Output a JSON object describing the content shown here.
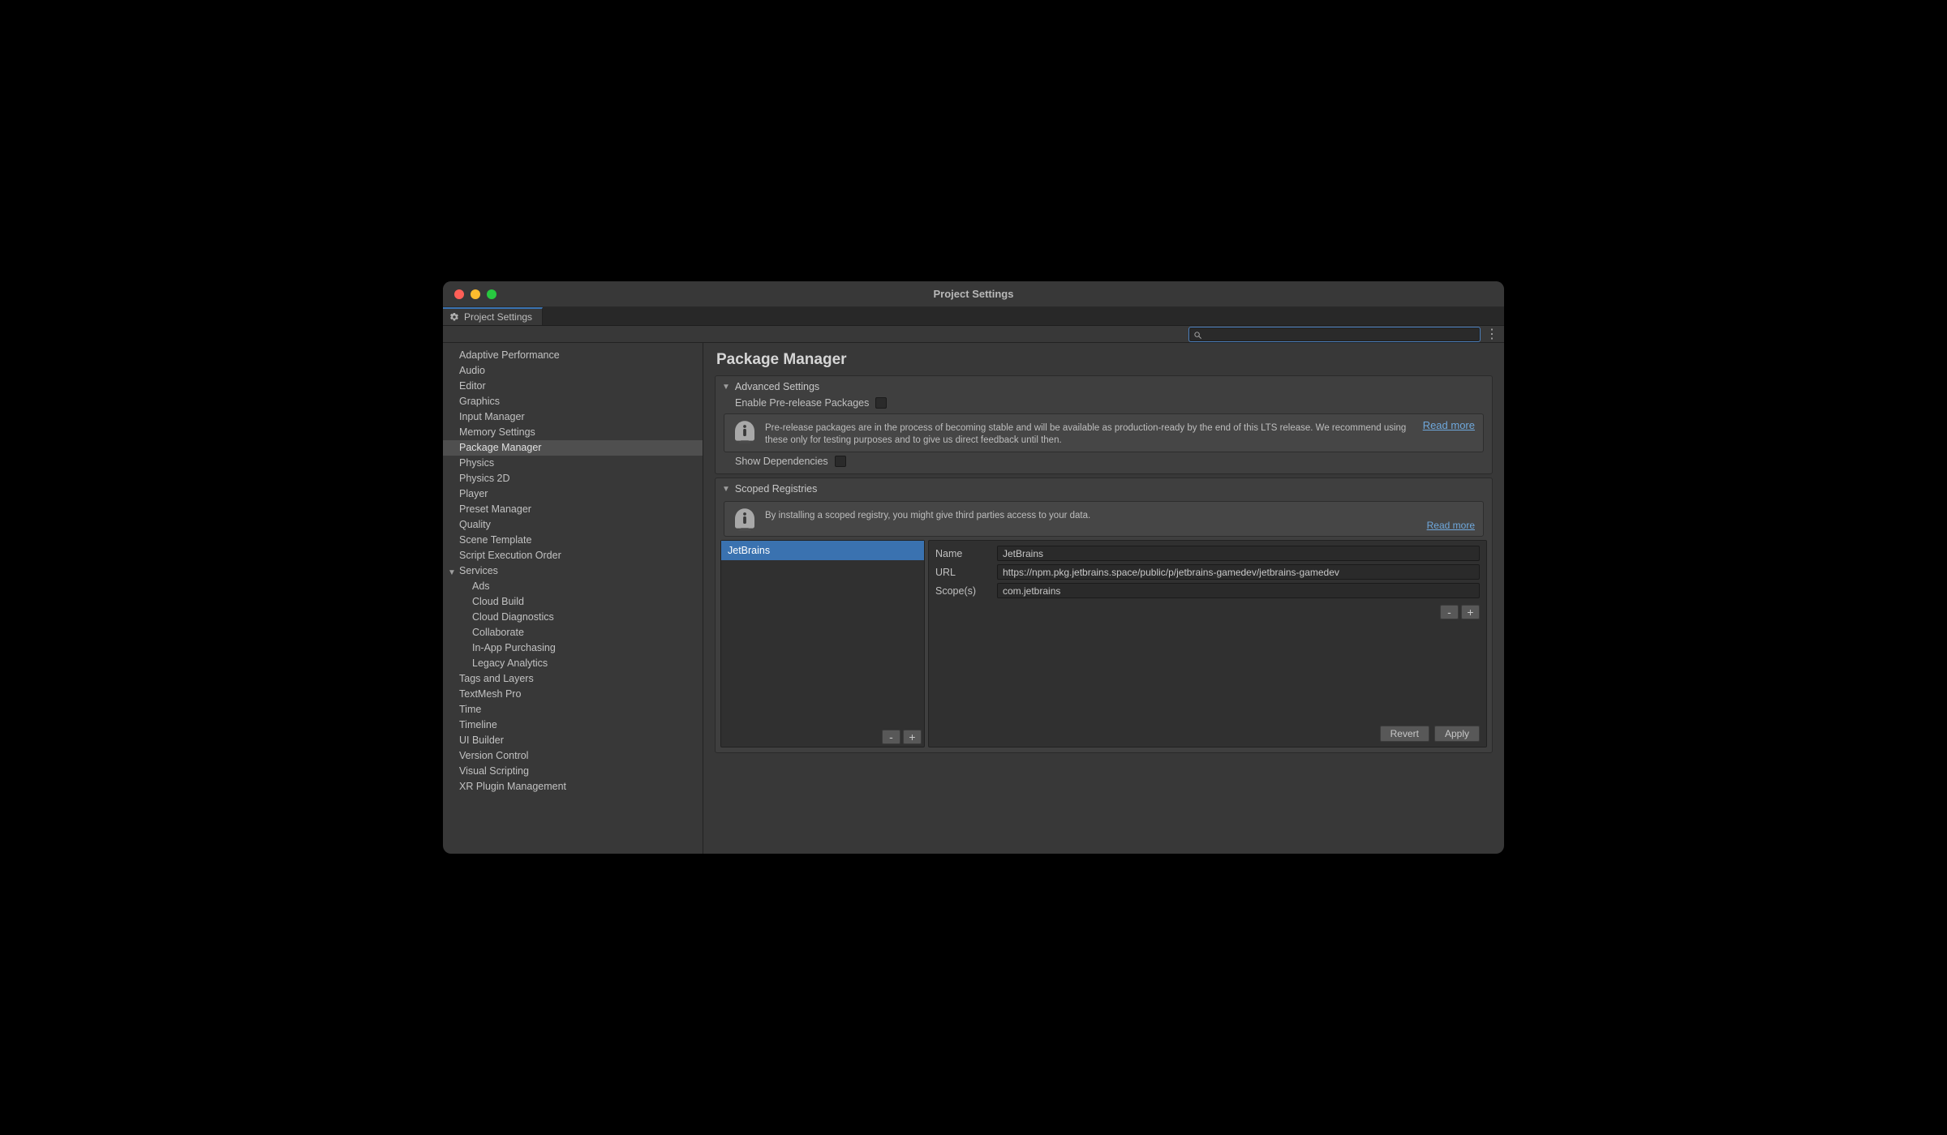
{
  "window": {
    "title": "Project Settings",
    "tab_label": "Project Settings"
  },
  "sidebar": {
    "items": [
      {
        "label": "Adaptive Performance",
        "selected": false
      },
      {
        "label": "Audio",
        "selected": false
      },
      {
        "label": "Editor",
        "selected": false
      },
      {
        "label": "Graphics",
        "selected": false
      },
      {
        "label": "Input Manager",
        "selected": false
      },
      {
        "label": "Memory Settings",
        "selected": false
      },
      {
        "label": "Package Manager",
        "selected": true
      },
      {
        "label": "Physics",
        "selected": false
      },
      {
        "label": "Physics 2D",
        "selected": false
      },
      {
        "label": "Player",
        "selected": false
      },
      {
        "label": "Preset Manager",
        "selected": false
      },
      {
        "label": "Quality",
        "selected": false
      },
      {
        "label": "Scene Template",
        "selected": false
      },
      {
        "label": "Script Execution Order",
        "selected": false
      },
      {
        "label": "Services",
        "selected": false,
        "has_children": true
      },
      {
        "label": "Ads",
        "selected": false,
        "child": true
      },
      {
        "label": "Cloud Build",
        "selected": false,
        "child": true
      },
      {
        "label": "Cloud Diagnostics",
        "selected": false,
        "child": true
      },
      {
        "label": "Collaborate",
        "selected": false,
        "child": true
      },
      {
        "label": "In-App Purchasing",
        "selected": false,
        "child": true
      },
      {
        "label": "Legacy Analytics",
        "selected": false,
        "child": true
      },
      {
        "label": "Tags and Layers",
        "selected": false
      },
      {
        "label": "TextMesh Pro",
        "selected": false
      },
      {
        "label": "Time",
        "selected": false
      },
      {
        "label": "Timeline",
        "selected": false
      },
      {
        "label": "UI Builder",
        "selected": false
      },
      {
        "label": "Version Control",
        "selected": false
      },
      {
        "label": "Visual Scripting",
        "selected": false
      },
      {
        "label": "XR Plugin Management",
        "selected": false
      }
    ]
  },
  "main": {
    "heading": "Package Manager",
    "advanced": {
      "title": "Advanced Settings",
      "enable_prerelease_label": "Enable Pre-release Packages",
      "enable_prerelease_checked": false,
      "info_text": "Pre-release packages are in the process of becoming stable and will be available as production-ready by the end of this LTS release. We recommend using these only for testing purposes and to give us direct feedback until then.",
      "read_more": "Read more",
      "show_dependencies_label": "Show Dependencies",
      "show_dependencies_checked": false
    },
    "scoped": {
      "title": "Scoped Registries",
      "info_text": "By installing a scoped registry, you might give third parties access to your data.",
      "read_more": "Read more",
      "registries": [
        {
          "name": "JetBrains",
          "selected": true
        }
      ],
      "fields": {
        "name_label": "Name",
        "name_value": "JetBrains",
        "url_label": "URL",
        "url_value": "https://npm.pkg.jetbrains.space/public/p/jetbrains-gamedev/jetbrains-gamedev",
        "scopes_label": "Scope(s)",
        "scopes_value": "com.jetbrains"
      },
      "buttons": {
        "minus": "-",
        "plus": "+",
        "revert": "Revert",
        "apply": "Apply"
      }
    }
  }
}
